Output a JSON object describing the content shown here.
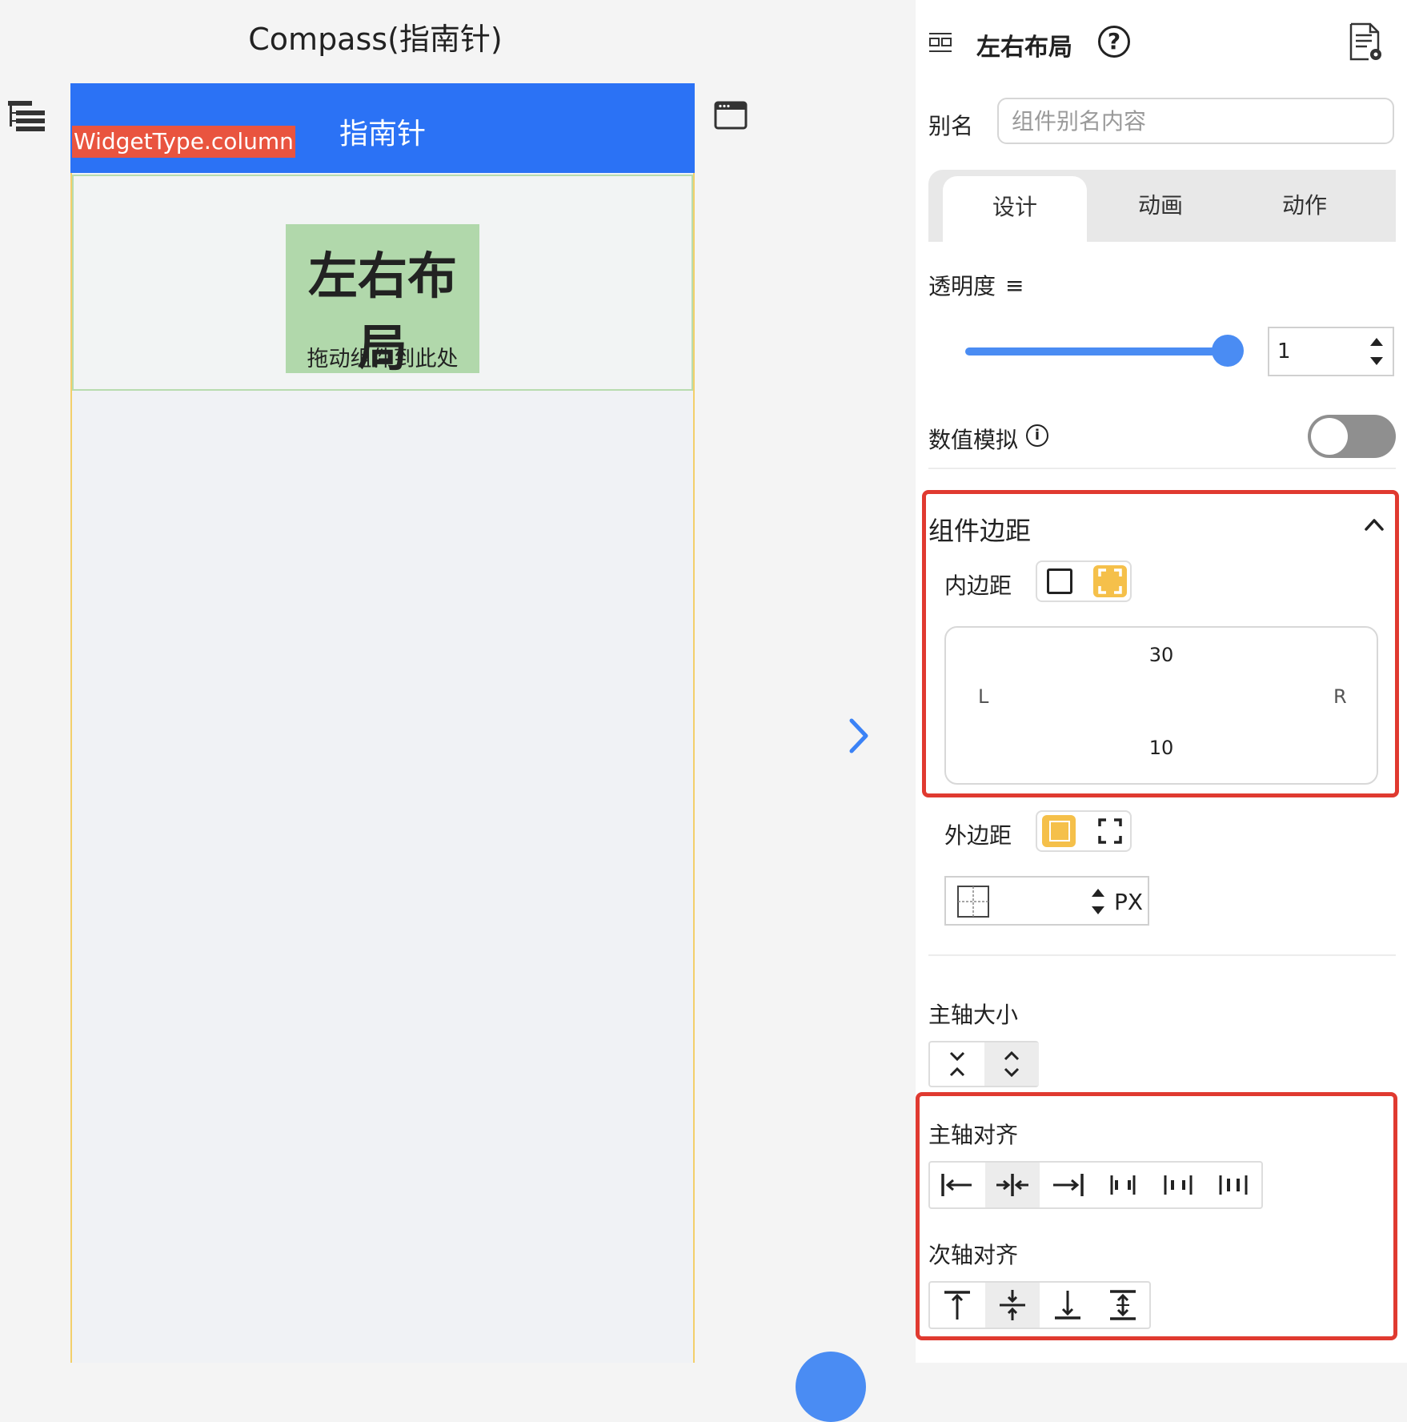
{
  "canvas": {
    "page_title": "Compass(指南针)",
    "app_bar_title": "指南针",
    "widget_tag": "WidgetType.column",
    "drop_target": {
      "title": "左右布局",
      "hint": "拖动组件到此处"
    },
    "icons": {
      "tree": "tree-list-icon",
      "window": "browser-window-icon",
      "collapse": "chevron-right-icon"
    }
  },
  "panel": {
    "header": {
      "title": "左右布局",
      "icons": [
        "layout-icon",
        "help-icon",
        "document-settings-icon"
      ],
      "help_glyph": "?"
    },
    "alias": {
      "label": "别名",
      "placeholder": "组件别名内容",
      "value": ""
    },
    "tabs": [
      {
        "label": "设计",
        "active": true
      },
      {
        "label": "动画",
        "active": false
      },
      {
        "label": "动作",
        "active": false
      }
    ],
    "opacity": {
      "label": "透明度",
      "menu_glyph": "≡",
      "value": "1",
      "slider_level": 1.0
    },
    "simulation": {
      "label": "数值模拟",
      "info_glyph": "i",
      "enabled": false
    },
    "margin_section": {
      "title": "组件边距",
      "expanded": true,
      "padding": {
        "label": "内边距",
        "mode": "separate",
        "top": "30",
        "left": "L",
        "right": "R",
        "bottom": "10"
      },
      "outer": {
        "label": "外边距",
        "mode": "all",
        "value": "",
        "unit": "PX"
      }
    },
    "main_axis_size": {
      "label": "主轴大小",
      "options": [
        "min-icon",
        "max-icon"
      ],
      "selected": 1
    },
    "main_axis_align": {
      "label": "主轴对齐",
      "options": [
        "align-start-icon",
        "align-center-icon",
        "align-end-icon",
        "space-between-icon",
        "space-around-icon",
        "space-evenly-icon"
      ],
      "selected": 1
    },
    "cross_axis_align": {
      "label": "次轴对齐",
      "options": [
        "align-top-icon",
        "align-middle-icon",
        "align-bottom-icon",
        "stretch-icon"
      ],
      "selected": 1
    },
    "colors": {
      "accent": "#2b72f5",
      "highlight": "#f5c04a",
      "annotation_red": "#e03a30",
      "tag_red": "#e9543f",
      "drop_green": "#b1d8ab"
    }
  }
}
